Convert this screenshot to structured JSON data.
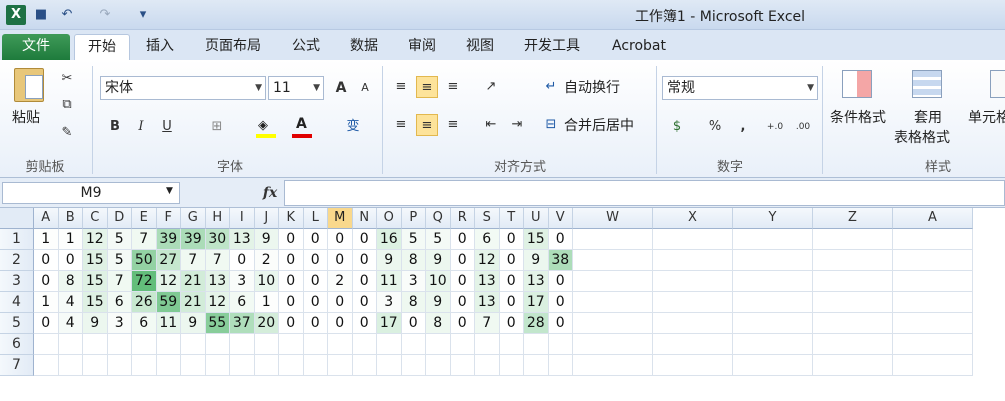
{
  "window": {
    "app_icon": "X",
    "title": "工作簿1 - Microsoft Excel"
  },
  "qat": {
    "save_icon": "■",
    "undo_icon": "↶",
    "redo_icon": "↷",
    "customize_icon": "▾"
  },
  "tabs": [
    {
      "id": "file",
      "label": "文件"
    },
    {
      "id": "home",
      "label": "开始"
    },
    {
      "id": "insert",
      "label": "插入"
    },
    {
      "id": "layout",
      "label": "页面布局"
    },
    {
      "id": "formulas",
      "label": "公式"
    },
    {
      "id": "data",
      "label": "数据"
    },
    {
      "id": "review",
      "label": "审阅"
    },
    {
      "id": "view",
      "label": "视图"
    },
    {
      "id": "developer",
      "label": "开发工具"
    },
    {
      "id": "acrobat",
      "label": "Acrobat"
    }
  ],
  "ribbon": {
    "clipboard": {
      "paste": "粘贴",
      "label": "剪贴板"
    },
    "font": {
      "name": "宋体",
      "size": "11",
      "label": "字体",
      "bold": "B",
      "italic": "I",
      "underline": "U",
      "font_color": "A",
      "grow": "A",
      "shrink": "A",
      "phonetic": "变"
    },
    "alignment": {
      "wrap": "自动换行",
      "merge": "合并后居中",
      "label": "对齐方式"
    },
    "number": {
      "format": "常规",
      "label": "数字",
      "percent": "%",
      "comma": ",",
      "inc_dec": "+.0",
      "dec_dec": ".00"
    },
    "styles": {
      "conditional": "条件格式",
      "table_line1": "套用",
      "table_line2": "表格格式",
      "cell_styles": "单元格",
      "label": "样式"
    }
  },
  "formula_bar": {
    "name_box": "M9",
    "fx": "fx",
    "value": ""
  },
  "sheet": {
    "columns": [
      "A",
      "B",
      "C",
      "D",
      "E",
      "F",
      "G",
      "H",
      "I",
      "J",
      "K",
      "L",
      "M",
      "N",
      "O",
      "P",
      "Q",
      "R",
      "S",
      "T",
      "U",
      "V",
      "W",
      "X",
      "Y",
      "Z",
      "A"
    ],
    "selected_column": "M",
    "rows": [
      "1",
      "2",
      "3",
      "4",
      "5",
      "6",
      "7"
    ],
    "values": [
      [
        1,
        1,
        12,
        5,
        7,
        39,
        39,
        30,
        13,
        9,
        0,
        0,
        0,
        0,
        16,
        5,
        5,
        0,
        6,
        0,
        15,
        0
      ],
      [
        0,
        0,
        15,
        5,
        50,
        27,
        7,
        7,
        0,
        2,
        0,
        0,
        0,
        0,
        9,
        8,
        9,
        0,
        12,
        0,
        9,
        38
      ],
      [
        0,
        8,
        15,
        7,
        72,
        12,
        21,
        13,
        3,
        10,
        0,
        0,
        2,
        0,
        11,
        3,
        10,
        0,
        13,
        0,
        13,
        0
      ],
      [
        1,
        4,
        15,
        6,
        26,
        59,
        21,
        12,
        6,
        1,
        0,
        0,
        0,
        0,
        3,
        8,
        9,
        0,
        13,
        0,
        17,
        0
      ],
      [
        0,
        4,
        9,
        3,
        6,
        11,
        9,
        55,
        37,
        20,
        0,
        0,
        0,
        0,
        17,
        0,
        8,
        0,
        7,
        0,
        28,
        0
      ]
    ],
    "heat_colors": {
      "low": "#ffffff",
      "high": "#63be7b"
    }
  }
}
